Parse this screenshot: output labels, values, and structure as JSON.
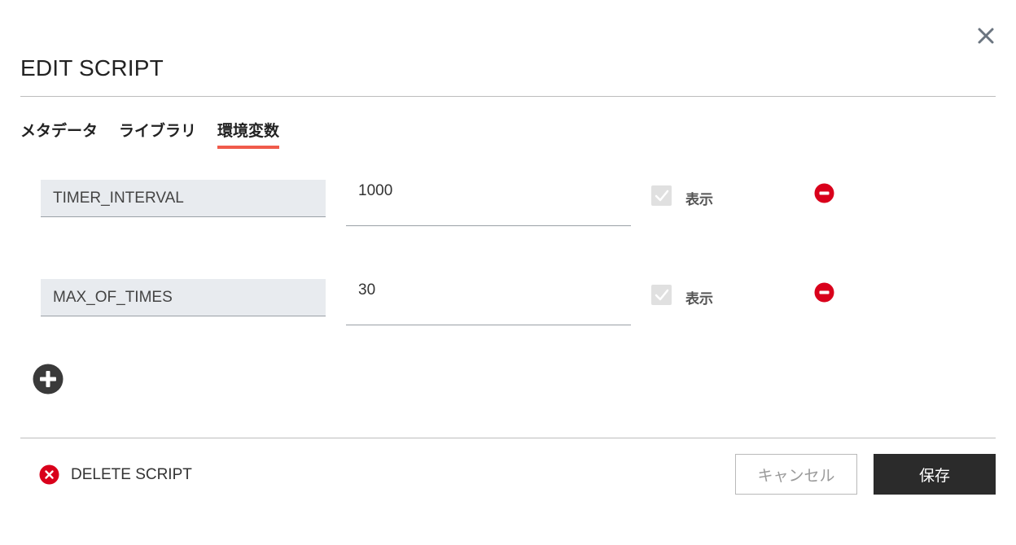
{
  "dialog": {
    "title": "EDIT SCRIPT",
    "close_icon": "close-icon"
  },
  "tabs": [
    {
      "label": "メタデータ",
      "active": false
    },
    {
      "label": "ライブラリ",
      "active": false
    },
    {
      "label": "環境変数",
      "active": true
    }
  ],
  "env_vars": [
    {
      "key": "TIMER_INTERVAL",
      "value": "1000",
      "display_label": "表示",
      "display_checked": true
    },
    {
      "key": "MAX_OF_TIMES",
      "value": "30",
      "display_label": "表示",
      "display_checked": true
    }
  ],
  "actions": {
    "add_icon": "plus-circle-icon",
    "remove_icon": "minus-circle-icon",
    "delete_label": "DELETE SCRIPT",
    "cancel_label": "キャンセル",
    "save_label": "保存"
  },
  "colors": {
    "tab_active_underline": "#f05b4b",
    "remove_red": "#d9001b",
    "save_bg": "#2b2b2b",
    "key_bg": "#e8ebef"
  }
}
